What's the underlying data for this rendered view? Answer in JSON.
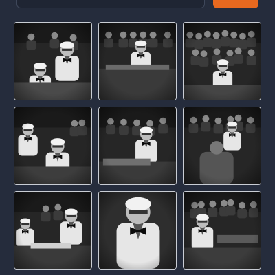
{
  "search": {
    "placeholder": "",
    "value": ""
  },
  "go_button": {
    "label": ""
  },
  "results": {
    "tiles": [
      {
        "name": "result-image-1",
        "variant": 1
      },
      {
        "name": "result-image-2",
        "variant": 2
      },
      {
        "name": "result-image-3",
        "variant": 3
      },
      {
        "name": "result-image-4",
        "variant": 4
      },
      {
        "name": "result-image-5",
        "variant": 5
      },
      {
        "name": "result-image-6",
        "variant": 6
      },
      {
        "name": "result-image-7",
        "variant": 7
      },
      {
        "name": "result-image-8",
        "variant": 8
      },
      {
        "name": "result-image-9",
        "variant": 9
      }
    ]
  },
  "colors": {
    "background": "#252c3c",
    "tile_border": "#c9cdd4",
    "accent": "#e8691f"
  }
}
